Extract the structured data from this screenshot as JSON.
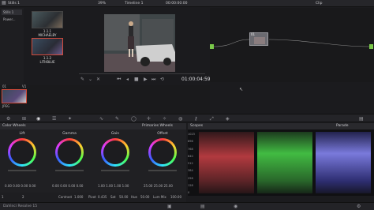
{
  "topbar": {
    "gallery_label": "Stills 1",
    "zoom": "39%",
    "timeline_name": "Timeline 1",
    "timecode_top": "00:00:00:00",
    "clip_label": "Clip"
  },
  "sidebar": {
    "items": [
      {
        "label": "Stills 1"
      },
      {
        "label": "Power..."
      }
    ]
  },
  "gallery": {
    "stills": [
      {
        "label": "1.1.1",
        "sublabel": "MICHAELBY"
      },
      {
        "label": "1.1.2",
        "sublabel": "LITHBLUE"
      }
    ]
  },
  "viewer": {
    "timecode": "01:00:04:59"
  },
  "nodes": {
    "node_label": "01"
  },
  "clips": {
    "clip_num": "01",
    "track": "V1",
    "clip_name": "JPEG"
  },
  "panels": {
    "color_wheels": "Color Wheels",
    "primaries_wheels": "Primaries Wheels",
    "scopes": "Scopes",
    "parade": "Parade"
  },
  "wheels": [
    {
      "label": "Lift",
      "values": [
        "0.00",
        "0.00",
        "0.00",
        "0.00"
      ]
    },
    {
      "label": "Gamma",
      "values": [
        "0.00",
        "0.00",
        "0.00",
        "0.00"
      ]
    },
    {
      "label": "Gain",
      "values": [
        "1.00",
        "1.00",
        "1.00",
        "1.00"
      ]
    },
    {
      "label": "Offset",
      "values": [
        "25.00",
        "25.00",
        "25.00"
      ]
    }
  ],
  "scope_ticks": [
    "1023",
    "896",
    "768",
    "640",
    "512",
    "384",
    "256",
    "128",
    "0"
  ],
  "adjustments": {
    "page": "1",
    "page2": "2",
    "contrast_label": "Contrast",
    "contrast_value": "1.000",
    "pivot_label": "Pivot",
    "pivot_value": "0.435",
    "sat_label": "Sat",
    "sat_value": "50.00",
    "hue_label": "Hue",
    "hue_value": "50.00",
    "lummix_label": "Lum Mix",
    "lummix_value": "100.00"
  },
  "bottombar": {
    "title": "DaVinci Resolve 15"
  },
  "colors": {
    "red_scope": "#e8484e",
    "green_scope": "#4ee64e",
    "blue_scope": "#5a5aff",
    "selection": "#d24a3a"
  }
}
